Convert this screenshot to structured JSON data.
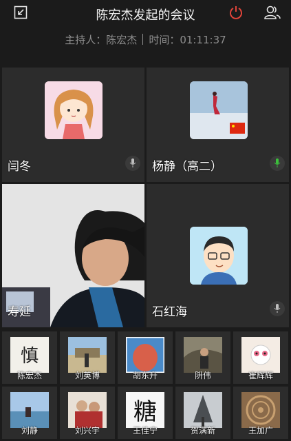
{
  "header": {
    "title": "陈宏杰发起的会议",
    "icons": [
      "minimize-window-icon",
      "power-icon",
      "participants-icon"
    ]
  },
  "meeting_info": {
    "host_label": "主持人：陈宏杰",
    "time_label": "时间：01:11:37"
  },
  "tiles": [
    {
      "name": "闫冬",
      "mic": "muted"
    },
    {
      "name": "杨静（高二）",
      "mic": "active"
    },
    {
      "name": "寿延",
      "mic": "none"
    },
    {
      "name": "石红海",
      "mic": "muted"
    }
  ],
  "thumb_row_1": [
    "陈宏杰",
    "刘英博",
    "胡东升",
    "阩伟",
    "崔辉辉"
  ],
  "thumb_row_2": [
    "刘静",
    "刘兴宇",
    "王佳宁",
    "贺满新",
    "王加广"
  ],
  "colors": {
    "background": "#1b1b1b",
    "tile": "#2c2c2c",
    "power_red": "#e0443a",
    "mic_active": "#3cc13c"
  }
}
